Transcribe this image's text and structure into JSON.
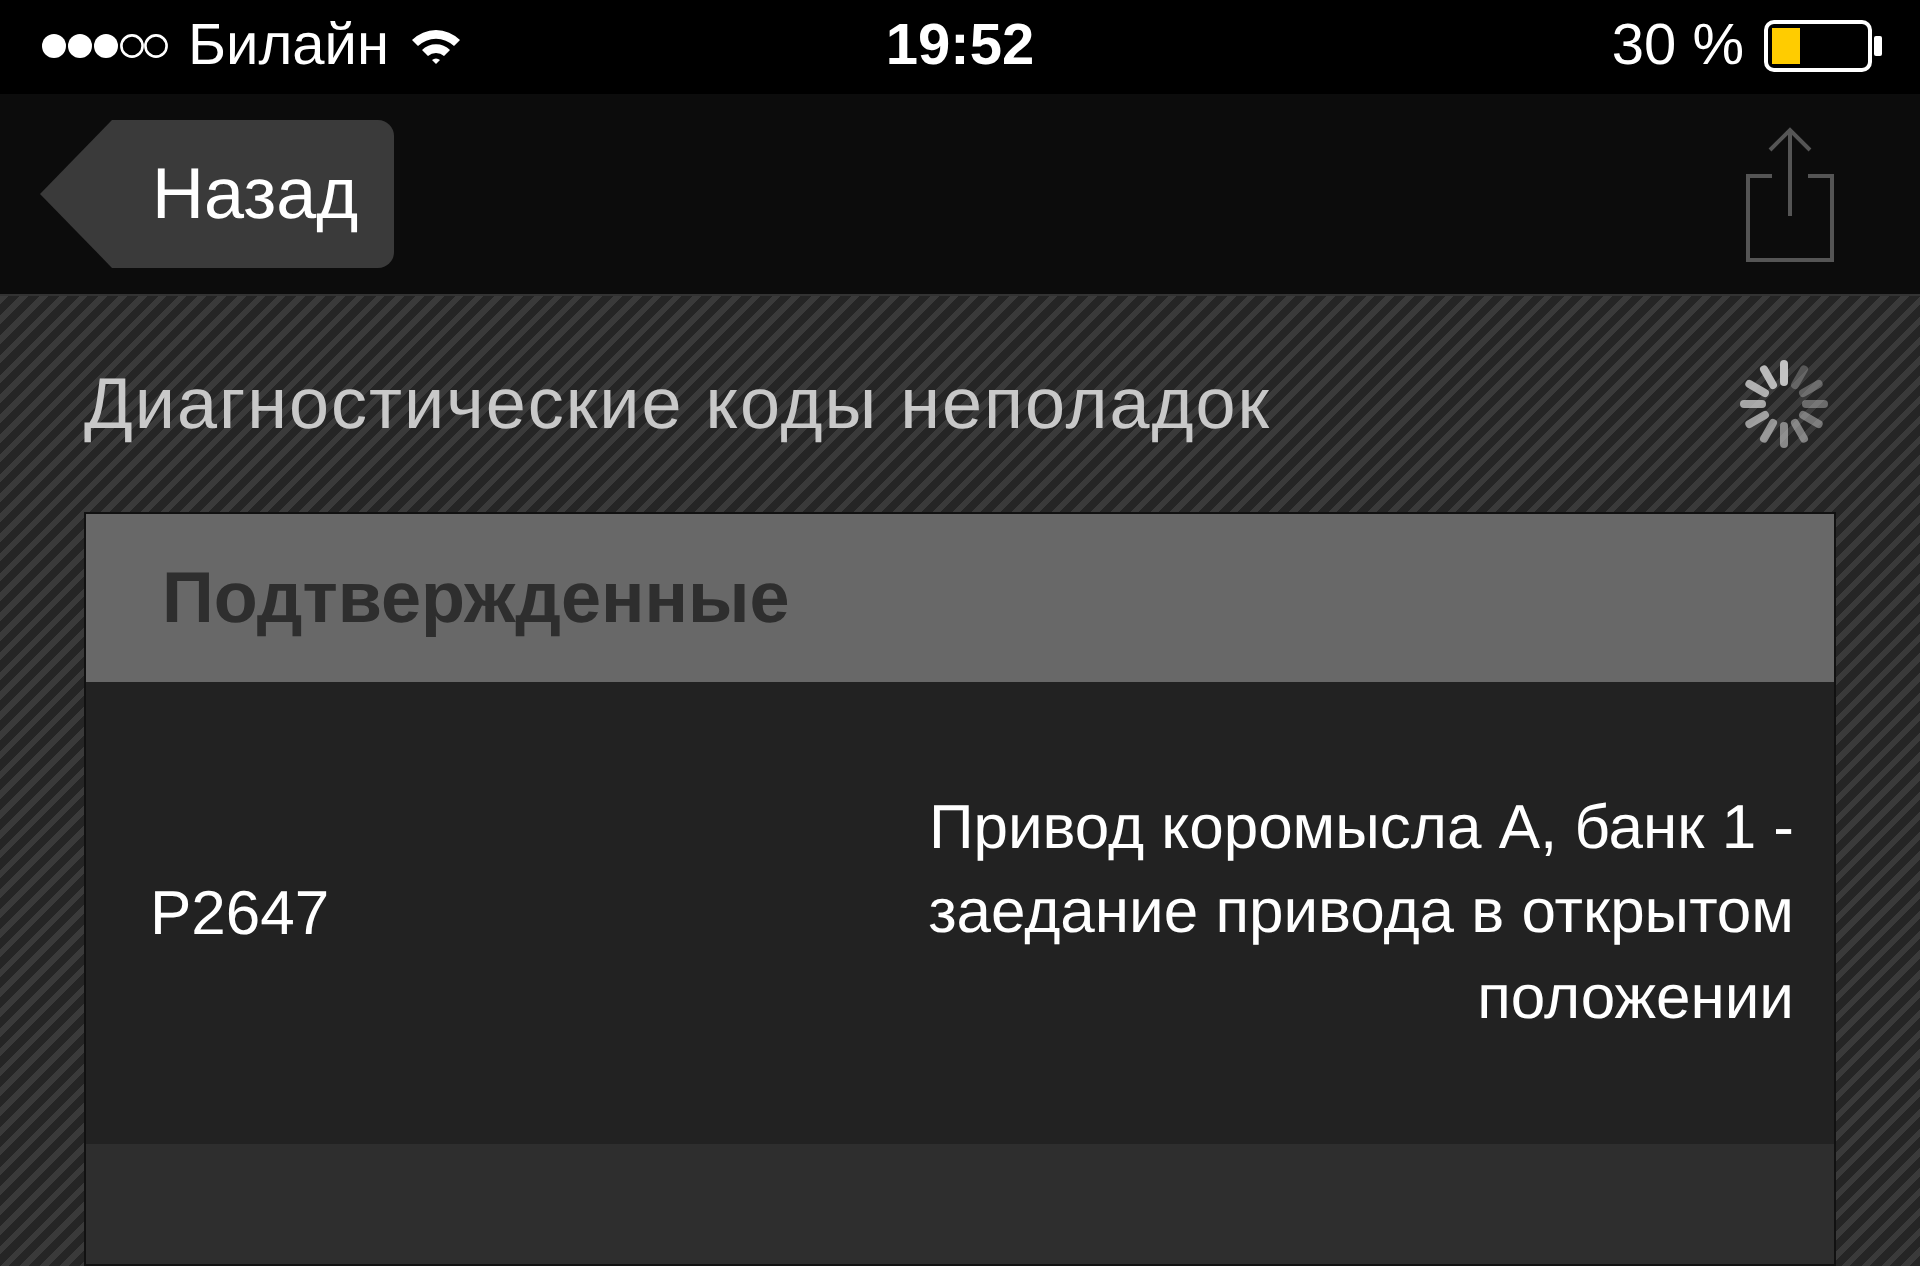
{
  "status_bar": {
    "carrier": "Билайн",
    "time": "19:52",
    "battery": "30 %"
  },
  "nav_bar": {
    "back": "Назад"
  },
  "title": "Диагностические коды неполадок",
  "sections": [
    {
      "header": "Подтвержденные",
      "rows": [
        {
          "code": "P2647",
          "description": "Привод коромысла A, банк 1 - заедание привода в открытом положении"
        }
      ]
    }
  ]
}
